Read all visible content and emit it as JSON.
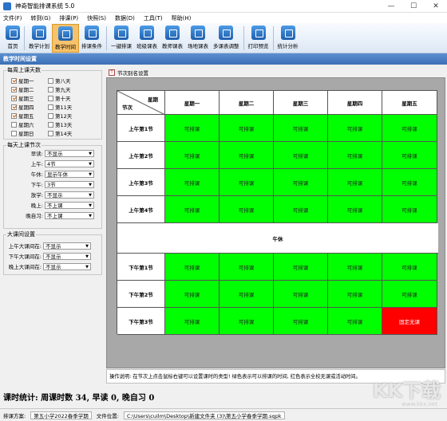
{
  "window": {
    "title": "神奇智能排课系统 5.0",
    "minimize": "—",
    "maximize": "☐",
    "close": "✕"
  },
  "menu": [
    "文件(F)",
    "转到(G)",
    "排课(P)",
    "快照(S)",
    "数据(D)",
    "工具(T)",
    "帮助(H)"
  ],
  "toolbar": [
    {
      "label": "首页",
      "icon": "home-icon"
    },
    {
      "label": "教学计划",
      "icon": "clipboard-icon"
    },
    {
      "label": "教学时间",
      "icon": "clock-icon",
      "active": true
    },
    {
      "label": "排课条件",
      "icon": "people-icon"
    },
    {
      "label": "一键排课",
      "icon": "hand-icon"
    },
    {
      "label": "班级课表",
      "icon": "grid-icon"
    },
    {
      "label": "教师课表",
      "icon": "teacher-icon"
    },
    {
      "label": "场地课表",
      "icon": "building-icon"
    },
    {
      "label": "多课表调整",
      "icon": "adjust-icon"
    },
    {
      "label": "打印预览",
      "icon": "print-icon"
    },
    {
      "label": "统计分析",
      "icon": "chart-icon"
    }
  ],
  "section_title": "教学时间设置",
  "days_group": {
    "legend": "每周上课天数",
    "days": [
      {
        "label": "星期一",
        "checked": true
      },
      {
        "label": "第八天",
        "checked": false
      },
      {
        "label": "星期二",
        "checked": true
      },
      {
        "label": "第九天",
        "checked": false
      },
      {
        "label": "星期三",
        "checked": true
      },
      {
        "label": "第十天",
        "checked": false
      },
      {
        "label": "星期四",
        "checked": true
      },
      {
        "label": "第11天",
        "checked": false
      },
      {
        "label": "星期五",
        "checked": true
      },
      {
        "label": "第12天",
        "checked": false
      },
      {
        "label": "星期六",
        "checked": false
      },
      {
        "label": "第13天",
        "checked": false
      },
      {
        "label": "星期日",
        "checked": false
      },
      {
        "label": "第14天",
        "checked": false
      }
    ]
  },
  "periods_group": {
    "legend": "每天上课节次",
    "rows": [
      {
        "label": "早读:",
        "value": "不显示"
      },
      {
        "label": "上午:",
        "value": "4节"
      },
      {
        "label": "午休:",
        "value": "显示午休"
      },
      {
        "label": "下午:",
        "value": "3节"
      },
      {
        "label": "放学:",
        "value": "不显示"
      },
      {
        "label": "晚上:",
        "value": "不上课"
      },
      {
        "label": "晚自习:",
        "value": "不上课"
      }
    ]
  },
  "break_group": {
    "legend": "大课间设置",
    "rows": [
      {
        "label": "上午大课间在:",
        "value": "不显示"
      },
      {
        "label": "下午大课间在:",
        "value": "不显示"
      },
      {
        "label": "晚上大课间在:",
        "value": "不显示"
      }
    ]
  },
  "tab": {
    "icon_text": "T",
    "label": "节次别名设置"
  },
  "grid": {
    "corner_top": "星期",
    "corner_bottom": "节次",
    "days": [
      "星期一",
      "星期二",
      "星期三",
      "星期四",
      "星期五"
    ],
    "morning": [
      "上午第1节",
      "上午第2节",
      "上午第3节",
      "上午第4节"
    ],
    "break_label": "午休",
    "afternoon": [
      "下午第1节",
      "下午第2节",
      "下午第3节"
    ],
    "slot_text": "可排课",
    "red_slot_text": "固定无课"
  },
  "note": "操作说明: 在节次上点击鼠标右键可以设置课时的类型! 绿色表示可以排课的时间, 红色表示全校无课或活动时间。",
  "stats": "课时统计: 周课时数 34, 早读 0, 晚自习 0",
  "status": {
    "plan_label": "排课方案:",
    "plan_value": "第五小学2022春季学期",
    "file_label": "文件位置:",
    "file_value": "C:\\Users\\cuilm\\Desktop\\新建文件夹 (3)\\第五小学春季学期.sqpk"
  },
  "watermark": {
    "text": "KK下载",
    "url": "www.kkx.net"
  }
}
